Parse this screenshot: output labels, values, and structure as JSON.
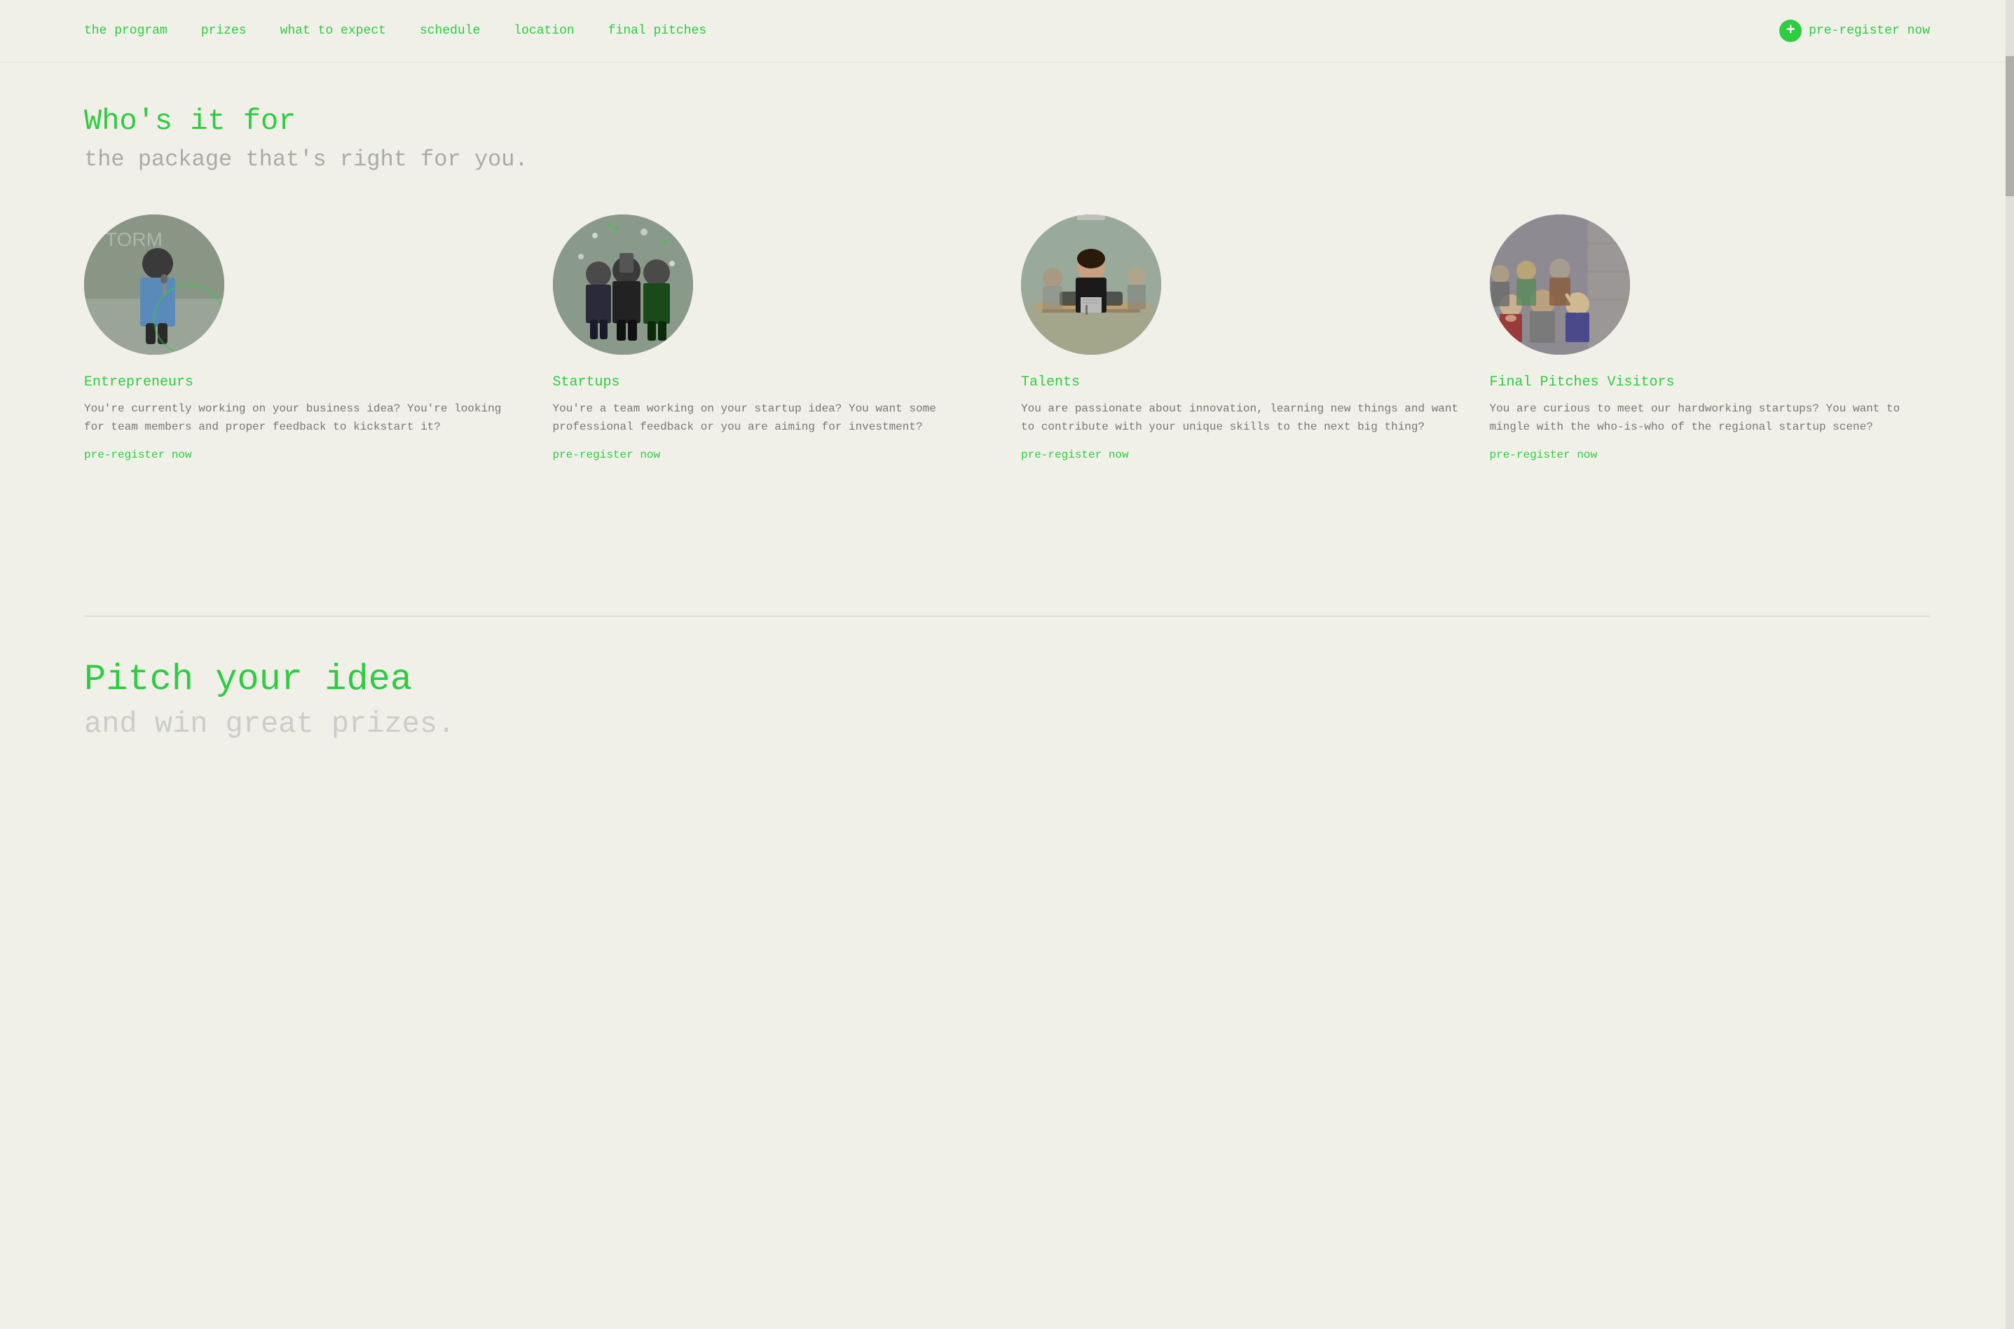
{
  "nav": {
    "links": [
      {
        "id": "the-program",
        "label": "the program"
      },
      {
        "id": "prizes",
        "label": "prizes"
      },
      {
        "id": "what-to-expect",
        "label": "what to expect"
      },
      {
        "id": "schedule",
        "label": "schedule"
      },
      {
        "id": "location",
        "label": "location"
      },
      {
        "id": "final-pitches",
        "label": "final pitches"
      }
    ],
    "cta_label": "pre-register now",
    "cta_icon": "+"
  },
  "whos_it_for": {
    "title": "Who's it for",
    "subtitle": "the package that's right for you.",
    "cards": [
      {
        "id": "entrepreneurs",
        "category": "Entrepreneurs",
        "description": "You're currently working on your business idea? You're looking for team members and proper feedback to kickstart it?",
        "link": "pre-register now"
      },
      {
        "id": "startups",
        "category": "Startups",
        "description": "You're a team working on your startup idea? You want some professional feedback or you are aiming for investment?",
        "link": "pre-register now"
      },
      {
        "id": "talents",
        "category": "Talents",
        "description": "You are passionate about innovation, learning new things and want to contribute with your unique skills to the next big thing?",
        "link": "pre-register now"
      },
      {
        "id": "final-pitches-visitors",
        "category": "Final Pitches Visitors",
        "description": "You are curious to meet our hardworking startups? You want to mingle with the who-is-who of the regional startup scene?",
        "link": "pre-register now"
      }
    ]
  },
  "bottom_section": {
    "title": "Pitch your idea",
    "subtitle": "and win great prizes."
  },
  "colors": {
    "green": "#2ecc40",
    "background": "#f0f0e8",
    "text_muted": "#777",
    "text_light": "#aaa"
  }
}
